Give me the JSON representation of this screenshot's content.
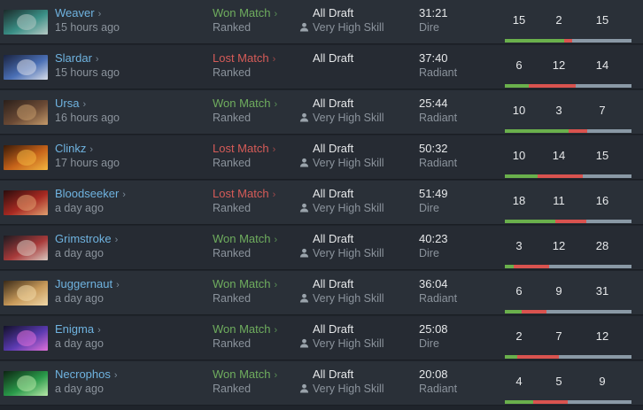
{
  "icons": {
    "chevron": "›",
    "person": "person-icon"
  },
  "colors": {
    "kills": "#6ab04c",
    "deaths": "#d9534f",
    "assists": "#8a99a6"
  },
  "matches": [
    {
      "hero": "Weaver",
      "time_ago": "15 hours ago",
      "result": "Won Match",
      "outcome": "win",
      "match_type": "Ranked",
      "mode": "All Draft",
      "skill": "Very High Skill",
      "duration": "31:21",
      "side": "Dire",
      "kills": 15,
      "deaths": 2,
      "assists": 15,
      "hero_colors": [
        "#1b2a2a",
        "#3a8f86",
        "#b7c9c4"
      ]
    },
    {
      "hero": "Slardar",
      "time_ago": "15 hours ago",
      "result": "Lost Match",
      "outcome": "loss",
      "match_type": "Ranked",
      "mode": "All Draft",
      "skill": "",
      "duration": "37:40",
      "side": "Radiant",
      "kills": 6,
      "deaths": 12,
      "assists": 14,
      "hero_colors": [
        "#1a2340",
        "#4a6fb5",
        "#d8dde8"
      ]
    },
    {
      "hero": "Ursa",
      "time_ago": "16 hours ago",
      "result": "Won Match",
      "outcome": "win",
      "match_type": "Ranked",
      "mode": "All Draft",
      "skill": "Very High Skill",
      "duration": "25:44",
      "side": "Radiant",
      "kills": 10,
      "deaths": 3,
      "assists": 7,
      "hero_colors": [
        "#2a1f1a",
        "#6b4a35",
        "#c49a6a"
      ]
    },
    {
      "hero": "Clinkz",
      "time_ago": "17 hours ago",
      "result": "Lost Match",
      "outcome": "loss",
      "match_type": "Ranked",
      "mode": "All Draft",
      "skill": "Very High Skill",
      "duration": "50:32",
      "side": "Radiant",
      "kills": 10,
      "deaths": 14,
      "assists": 15,
      "hero_colors": [
        "#3a1a08",
        "#c8641a",
        "#f2b640"
      ]
    },
    {
      "hero": "Bloodseeker",
      "time_ago": "a day ago",
      "result": "Lost Match",
      "outcome": "loss",
      "match_type": "Ranked",
      "mode": "All Draft",
      "skill": "Very High Skill",
      "duration": "51:49",
      "side": "Dire",
      "kills": 18,
      "deaths": 11,
      "assists": 16,
      "hero_colors": [
        "#2a0c0c",
        "#a82a22",
        "#e0a070"
      ]
    },
    {
      "hero": "Grimstroke",
      "time_ago": "a day ago",
      "result": "Won Match",
      "outcome": "win",
      "match_type": "Ranked",
      "mode": "All Draft",
      "skill": "Very High Skill",
      "duration": "40:23",
      "side": "Dire",
      "kills": 3,
      "deaths": 12,
      "assists": 28,
      "hero_colors": [
        "#1e1a20",
        "#a83a3a",
        "#d8c8c0"
      ]
    },
    {
      "hero": "Juggernaut",
      "time_ago": "a day ago",
      "result": "Won Match",
      "outcome": "win",
      "match_type": "Ranked",
      "mode": "All Draft",
      "skill": "Very High Skill",
      "duration": "36:04",
      "side": "Radiant",
      "kills": 6,
      "deaths": 9,
      "assists": 31,
      "hero_colors": [
        "#3a2a18",
        "#c89a5a",
        "#f0d8a8"
      ]
    },
    {
      "hero": "Enigma",
      "time_ago": "a day ago",
      "result": "Won Match",
      "outcome": "win",
      "match_type": "Ranked",
      "mode": "All Draft",
      "skill": "Very High Skill",
      "duration": "25:08",
      "side": "Dire",
      "kills": 2,
      "deaths": 7,
      "assists": 12,
      "hero_colors": [
        "#12102a",
        "#5a3ab0",
        "#e070d8"
      ]
    },
    {
      "hero": "Necrophos",
      "time_ago": "a day ago",
      "result": "Won Match",
      "outcome": "win",
      "match_type": "Ranked",
      "mode": "All Draft",
      "skill": "Very High Skill",
      "duration": "20:08",
      "side": "Radiant",
      "kills": 4,
      "deaths": 5,
      "assists": 9,
      "hero_colors": [
        "#0c2412",
        "#2a9a4a",
        "#b8e8a8"
      ]
    }
  ]
}
